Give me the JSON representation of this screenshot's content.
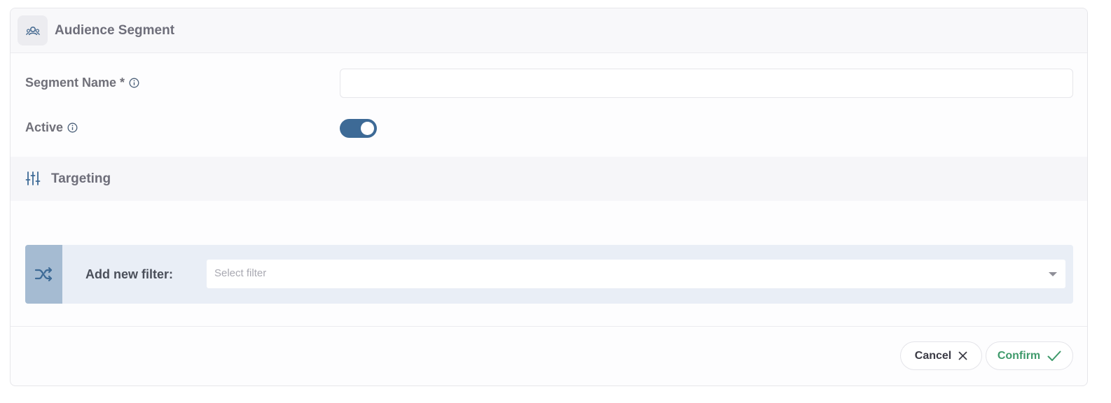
{
  "header": {
    "title": "Audience Segment",
    "icon": "audience-icon"
  },
  "form": {
    "segment_name": {
      "label": "Segment Name *",
      "value": "",
      "placeholder": ""
    },
    "active": {
      "label": "Active",
      "checked": true
    }
  },
  "targeting": {
    "title": "Targeting",
    "add_filter_label": "Add new filter:",
    "select_placeholder": "Select filter"
  },
  "footer": {
    "cancel_label": "Cancel",
    "confirm_label": "Confirm"
  },
  "colors": {
    "toggle_on": "#3d6a96",
    "confirm_text": "#3f9a6b",
    "filter_row_bg": "#e9eef6",
    "filter_icon_bg": "#a5bbd2"
  }
}
